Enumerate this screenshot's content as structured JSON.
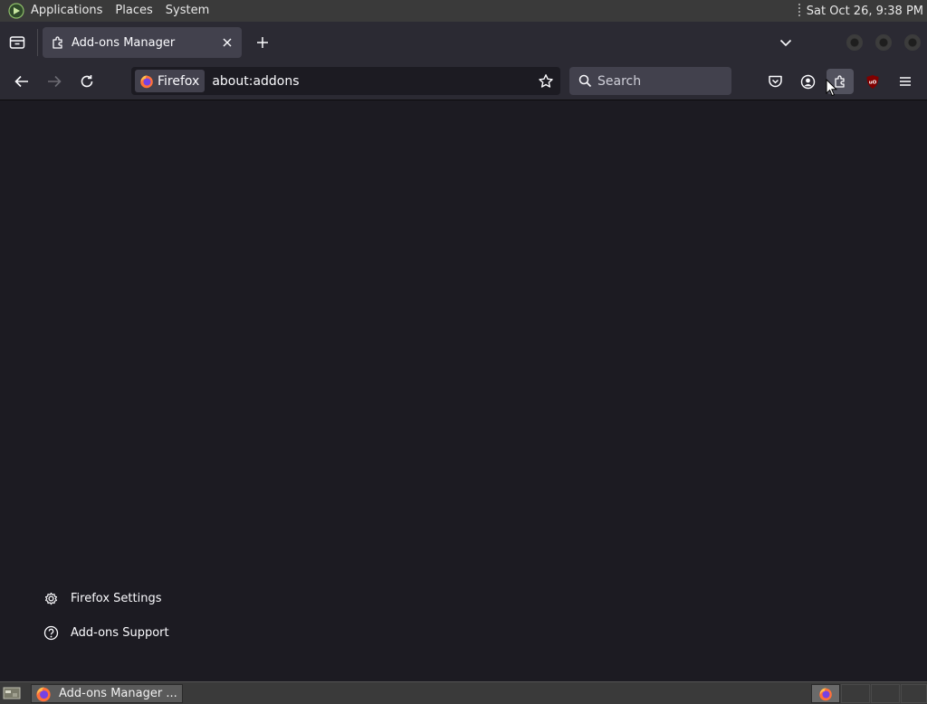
{
  "top_panel": {
    "menus": [
      "Applications",
      "Places",
      "System"
    ],
    "clock": "Sat Oct 26,  9:38 PM",
    "distro_icon": "linux-mint-like-icon"
  },
  "tabs": [
    {
      "title": "Add-ons Manager",
      "icon": "puzzle-icon",
      "active": true
    }
  ],
  "toolbar": {
    "url": "about:addons",
    "identity_label": "Firefox",
    "search_placeholder": "Search",
    "buttons": [
      "back",
      "forward",
      "reload",
      "bookmark-star",
      "pocket",
      "account",
      "extensions",
      "ublock-origin",
      "app-menu"
    ]
  },
  "content": {
    "links": [
      {
        "label": "Firefox Settings",
        "icon": "gear-icon"
      },
      {
        "label": "Add-ons Support",
        "icon": "help-circle-icon"
      }
    ]
  },
  "taskbar": {
    "window_label": "Add-ons Manager ...",
    "window_icon": "firefox-icon"
  },
  "colors": {
    "panel_bg": "#3a3a3a",
    "toolbar_bg": "#2b2a33",
    "content_bg": "#1c1b22",
    "tab_active_bg": "#42414d",
    "text": "#fbfbfe",
    "ublock_red": "#800000"
  }
}
